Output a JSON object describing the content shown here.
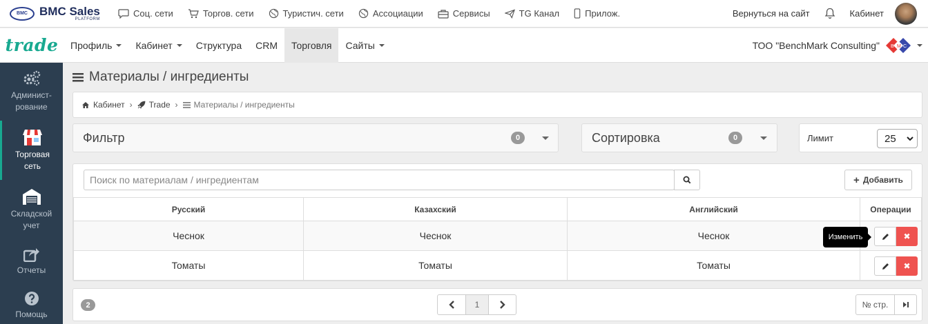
{
  "topbar": {
    "logo_mark": "BMC",
    "logo_title": "BMC Sales",
    "logo_sub": "PLATFORM",
    "nav": [
      {
        "label": "Соц. сети",
        "icon": "chat-icon"
      },
      {
        "label": "Торгов. сети",
        "icon": "cart-icon"
      },
      {
        "label": "Туристич. сети",
        "icon": "globe-icon"
      },
      {
        "label": "Ассоциации",
        "icon": "globe-icon"
      },
      {
        "label": "Сервисы",
        "icon": "briefcase-icon"
      },
      {
        "label": "TG Канал",
        "icon": "telegram-icon"
      },
      {
        "label": "Прилож.",
        "icon": "mobile-icon"
      }
    ],
    "back_link": "Вернуться на сайт",
    "cabinet": "Кабинет"
  },
  "navbar": {
    "brand": "trade",
    "items": [
      {
        "label": "Профиль",
        "dropdown": true
      },
      {
        "label": "Кабинет",
        "dropdown": true
      },
      {
        "label": "Структура",
        "dropdown": false
      },
      {
        "label": "CRM",
        "dropdown": false
      },
      {
        "label": "Торговля",
        "dropdown": false,
        "active": true
      },
      {
        "label": "Сайты",
        "dropdown": true
      }
    ],
    "company": "ТОО \"BenchMark Consulting\"",
    "company_logo_letters": [
      "B",
      "M",
      "C"
    ]
  },
  "sidebar": {
    "items": [
      {
        "label": "Админист-рование",
        "icon": "gears-icon"
      },
      {
        "label": "Торговая сеть",
        "icon": "shop-icon",
        "active": true
      },
      {
        "label": "Складской учет",
        "icon": "warehouse-icon"
      },
      {
        "label": "Отчеты",
        "icon": "share-icon"
      },
      {
        "label": "Помощь",
        "icon": "help-icon"
      }
    ]
  },
  "page": {
    "title": "Материалы / ингредиенты",
    "breadcrumb": [
      "Кабинет",
      "Trade",
      "Материалы / ингредиенты"
    ]
  },
  "filter": {
    "label": "Фильтр",
    "count": "0"
  },
  "sort": {
    "label": "Сортировка",
    "count": "0"
  },
  "limit": {
    "label": "Лимит",
    "value": "25"
  },
  "search": {
    "placeholder": "Поиск по материалам / ингредиентам"
  },
  "add_button": "Добавить",
  "table": {
    "headers": [
      "Русский",
      "Казахский",
      "Английский",
      "Операции"
    ],
    "rows": [
      [
        "Чеснок",
        "Чеснок",
        "Чеснок"
      ],
      [
        "Томаты",
        "Томаты",
        "Томаты"
      ]
    ],
    "edit_tooltip": "Изменить"
  },
  "pagination": {
    "total": "2",
    "current_page": "1",
    "page_no_label": "№ стр."
  },
  "colors": {
    "accent": "#18a990",
    "sidebar": "#2c3e50",
    "danger": "#ef5350"
  }
}
